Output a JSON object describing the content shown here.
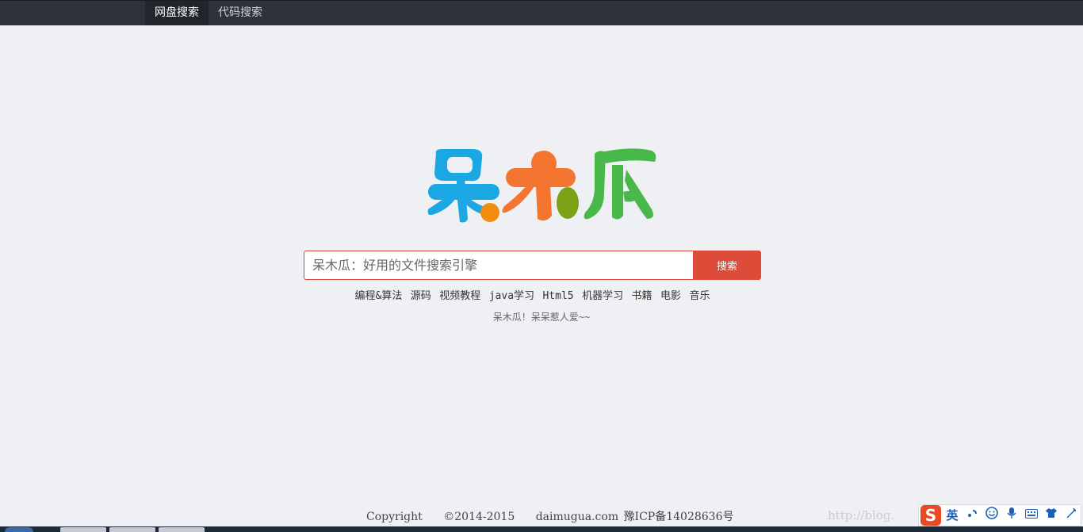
{
  "nav": {
    "tabs": [
      {
        "label": "网盘搜索",
        "active": true
      },
      {
        "label": "代码搜索",
        "active": false
      }
    ]
  },
  "logo": {
    "text": "呆木瓜",
    "colors": [
      "#1ba7e4",
      "#f47530",
      "#48b84a",
      "#f08c10",
      "#7ba117"
    ]
  },
  "search": {
    "placeholder": "呆木瓜：好用的文件搜索引擎",
    "value": "",
    "button_label": "搜索",
    "accent": "#dd4b39"
  },
  "hotwords": [
    "编程&算法",
    "源码",
    "视频教程",
    "java学习",
    "Html5",
    "机器学习",
    "书籍",
    "电影",
    "音乐"
  ],
  "slogan": "呆木瓜！呆呆惹人爱~~",
  "footer": {
    "copyright": "Copyright",
    "years": "©2014-2015",
    "domain": "daimugua.com",
    "icp": "豫ICP备14028636号"
  },
  "watermark": "http://blog.",
  "ime": {
    "logo": "S",
    "lang": "英",
    "icons": [
      "punctuation-icon",
      "emoji-icon",
      "microphone-icon",
      "keyboard-icon",
      "skin-icon",
      "settings-icon",
      "wrench-icon"
    ]
  },
  "colors": {
    "topbar": "#2d323c",
    "background": "#eff0f3"
  }
}
